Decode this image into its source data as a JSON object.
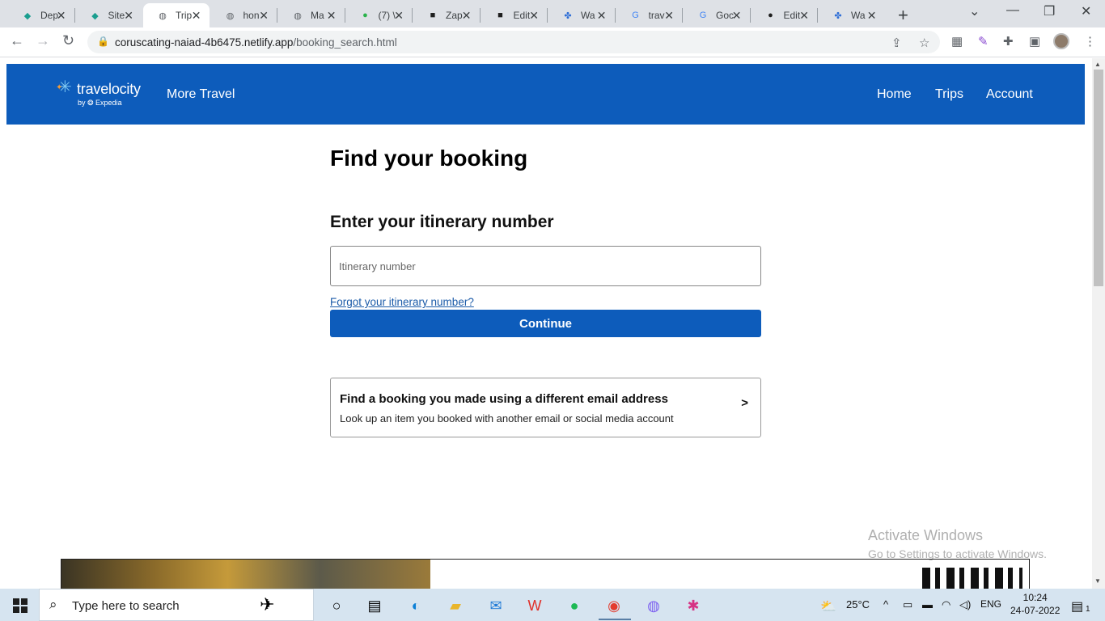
{
  "browser": {
    "tabs": [
      {
        "title": "Dep",
        "icon": "diamond-teal-icon",
        "active": false
      },
      {
        "title": "Site",
        "icon": "diamond-teal-icon",
        "active": false
      },
      {
        "title": "Trip",
        "icon": "globe-icon",
        "active": true
      },
      {
        "title": "hon",
        "icon": "globe-icon",
        "active": false
      },
      {
        "title": "Ma",
        "icon": "globe-icon",
        "active": false
      },
      {
        "title": "(7) \\",
        "icon": "green-badge-icon",
        "active": false
      },
      {
        "title": "Zap",
        "icon": "zap-icon",
        "active": false
      },
      {
        "title": "Edit",
        "icon": "zap-icon",
        "active": false
      },
      {
        "title": "Wa",
        "icon": "pinwheel-icon",
        "active": false
      },
      {
        "title": "trav",
        "icon": "google-icon",
        "active": false
      },
      {
        "title": "Goc",
        "icon": "google-translate-icon",
        "active": false
      },
      {
        "title": "Edit",
        "icon": "github-icon",
        "active": false
      },
      {
        "title": "Wa",
        "icon": "pinwheel-icon",
        "active": false
      }
    ],
    "url_host": "coruscating-naiad-4b6475.netlify.app",
    "url_path": "/booking_search.html"
  },
  "header": {
    "brand": "travelocity",
    "byline": "by ❂ Expedia",
    "more_travel": "More Travel",
    "nav": [
      "Home",
      "Trips",
      "Account"
    ]
  },
  "main": {
    "title": "Find your booking",
    "subtitle": "Enter your itinerary number",
    "input_placeholder": "Itinerary number",
    "forgot_link": "Forgot your itinerary number?",
    "continue_label": "Continue",
    "card_title": "Find a booking you made using a different email address",
    "card_subtitle": "Look up an item you booked with another email or social media account",
    "card_chevron": ">"
  },
  "watermark": {
    "line1": "Activate Windows",
    "line2": "Go to Settings to activate Windows."
  },
  "taskbar": {
    "search_placeholder": "Type here to search",
    "weather": "25°C",
    "language": "ENG",
    "time": "10:24",
    "date": "24-07-2022",
    "notification_count": "1"
  }
}
